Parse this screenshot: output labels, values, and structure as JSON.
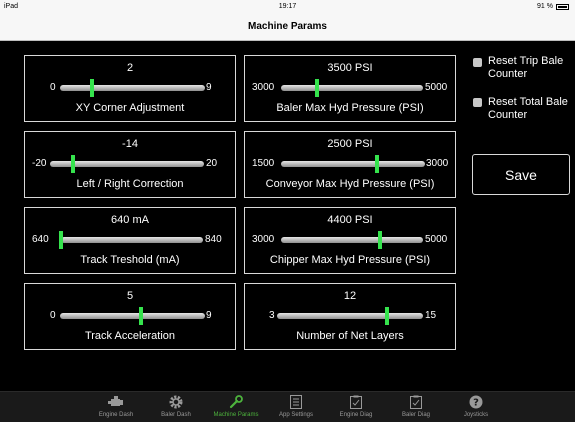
{
  "status_bar": {
    "device": "iPad",
    "time": "19:17",
    "battery": "91 %"
  },
  "nav": {
    "title": "Machine Params"
  },
  "params": [
    {
      "value": "2",
      "min": "0",
      "max": "9",
      "label": "XY Corner Adjustment",
      "level": 0.22
    },
    {
      "value": "3500 PSI",
      "min": "3000",
      "max": "5000",
      "label": "Baler Max Hyd Pressure (PSI)",
      "level": 0.25
    },
    {
      "value": "-14",
      "min": "-20",
      "max": "20",
      "label": "Left / Right Correction",
      "level": 0.15
    },
    {
      "value": "2500 PSI",
      "min": "1500",
      "max": "3000",
      "label": "Conveyor Max Hyd Pressure (PSI)",
      "level": 0.67
    },
    {
      "value": "640 mA",
      "min": "640",
      "max": "840",
      "label": "Track Treshold (mA)",
      "level": 0.0
    },
    {
      "value": "4400 PSI",
      "min": "3000",
      "max": "5000",
      "label": "Chipper Max Hyd Pressure (PSI)",
      "level": 0.7
    },
    {
      "value": "5",
      "min": "0",
      "max": "9",
      "label": "Track Acceleration",
      "level": 0.56
    },
    {
      "value": "12",
      "min": "3",
      "max": "15",
      "label": "Number of Net Layers",
      "level": 0.75
    }
  ],
  "options": {
    "reset_trip": "Reset Trip Bale Counter",
    "reset_total": "Reset Total Bale Counter",
    "save": "Save"
  },
  "tabs": [
    {
      "label": "Engine Dash",
      "icon": "engine-icon"
    },
    {
      "label": "Baler Dash",
      "icon": "gear-icon"
    },
    {
      "label": "Machine Params",
      "icon": "wrench-icon"
    },
    {
      "label": "App Settings",
      "icon": "list-icon"
    },
    {
      "label": "Engine Diag",
      "icon": "clipboard-icon"
    },
    {
      "label": "Baler Diag",
      "icon": "clipboard-icon"
    },
    {
      "label": "Joysticks",
      "icon": "help-icon"
    }
  ],
  "colors": {
    "accent": "#35e34d",
    "active_tab": "#4db33d",
    "background": "#000000"
  }
}
